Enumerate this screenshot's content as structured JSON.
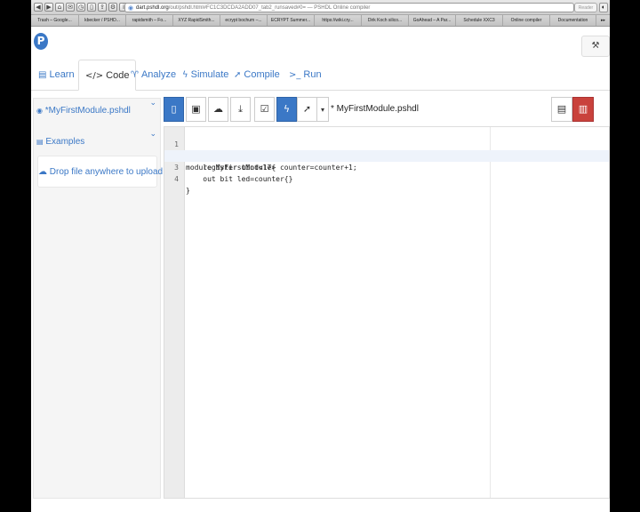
{
  "browser": {
    "url_host": "dart.pshdl.org",
    "url_rest": "/out/pshdl.html#FC1C3DCDA2ADD07_tab2_runsaved#0= — PSHDL Online compiler",
    "reader_label": "Reader",
    "bookmarks": [
      "Trash – Google...",
      "kbecker / PSHD...",
      "rapidsmith – Fo...",
      "XYZ RapidSmith...",
      "ecrypt bochum –...",
      "ECRYPT Summer...",
      "https://wiki.cry...",
      "Dirk Koch silico...",
      "GoAhead – A Par...",
      "Schedule XXC3",
      "Online compiler",
      "Documentation"
    ]
  },
  "app": {
    "logo": "P",
    "nav": [
      {
        "label": "Learn",
        "icon": "book-icon",
        "glyph": "▤"
      },
      {
        "label": "Code",
        "icon": "code-icon",
        "glyph": "</>"
      },
      {
        "label": "Analyze",
        "icon": "stethoscope-icon",
        "glyph": "♈"
      },
      {
        "label": "Simulate",
        "icon": "bolt-icon",
        "glyph": "ϟ"
      },
      {
        "label": "Compile",
        "icon": "rocket-icon",
        "glyph": "🚀"
      },
      {
        "label": "Run",
        "icon": "terminal-icon",
        "glyph": ">_"
      }
    ],
    "active_tab": "Code"
  },
  "sidebar": {
    "module_label": "*MyFirstModule.pshdl",
    "examples_label": "Examples",
    "drop_label": "Drop file anywhere to upload"
  },
  "editor": {
    "tab_label": "* MyFirstModule.pshdl",
    "lines": [
      {
        "num": "1",
        "fold": "▾",
        "text": "module MyFirstModule{"
      },
      {
        "num": "2",
        "fold": "",
        "text": "    register uint<17> counter=counter+1;"
      },
      {
        "num": "3",
        "fold": "",
        "text": "    out bit led=counter{}"
      },
      {
        "num": "4",
        "fold": "",
        "text": "}"
      }
    ],
    "highlighted_line": 3
  },
  "colors": {
    "accent": "#3b78c6",
    "danger": "#c9423c"
  }
}
